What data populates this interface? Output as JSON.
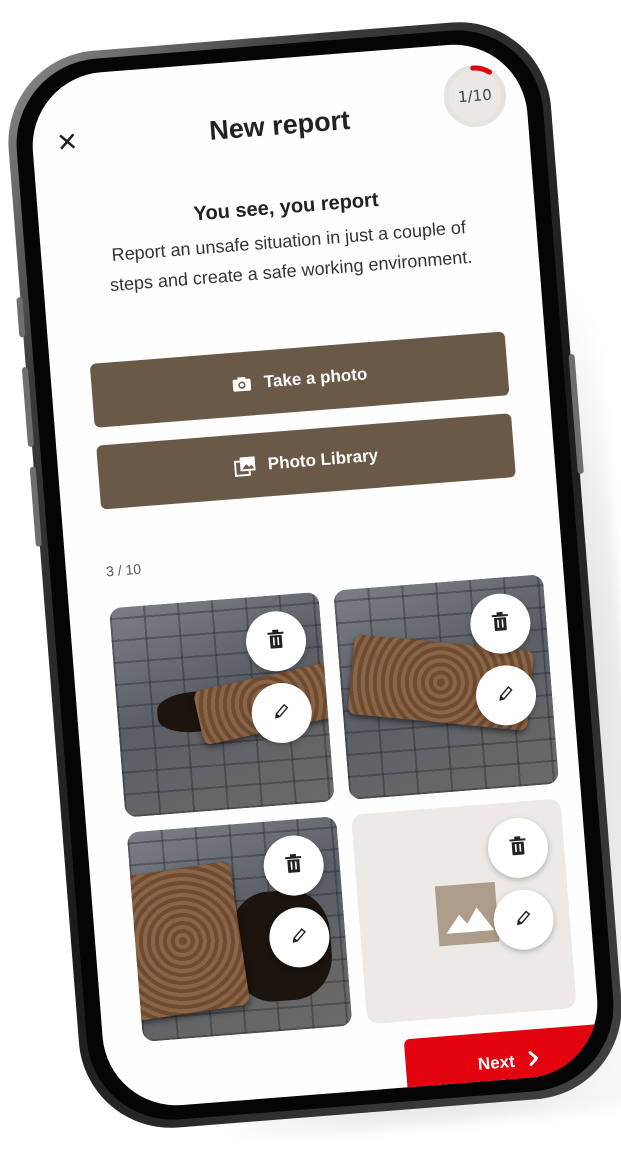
{
  "header": {
    "title": "New report",
    "progress": "1/10",
    "progress_fraction": 0.1,
    "accent_color": "#e3030f"
  },
  "intro": {
    "heading": "You see, you report",
    "body": "Report an unsafe situation in just a couple of steps and create a safe working environment."
  },
  "actions": {
    "take_photo": "Take a photo",
    "photo_library": "Photo Library",
    "button_color": "#6b5948"
  },
  "photos": {
    "counter": "3 / 10",
    "tiles": [
      {
        "kind": "photo",
        "delete_icon": "trash-icon",
        "edit_icon": "pencil-icon"
      },
      {
        "kind": "photo",
        "delete_icon": "trash-icon",
        "edit_icon": "pencil-icon"
      },
      {
        "kind": "photo",
        "delete_icon": "trash-icon",
        "edit_icon": "pencil-icon"
      },
      {
        "kind": "placeholder",
        "delete_icon": "trash-icon",
        "edit_icon": "pencil-icon"
      }
    ]
  },
  "footer": {
    "next_label": "Next"
  }
}
